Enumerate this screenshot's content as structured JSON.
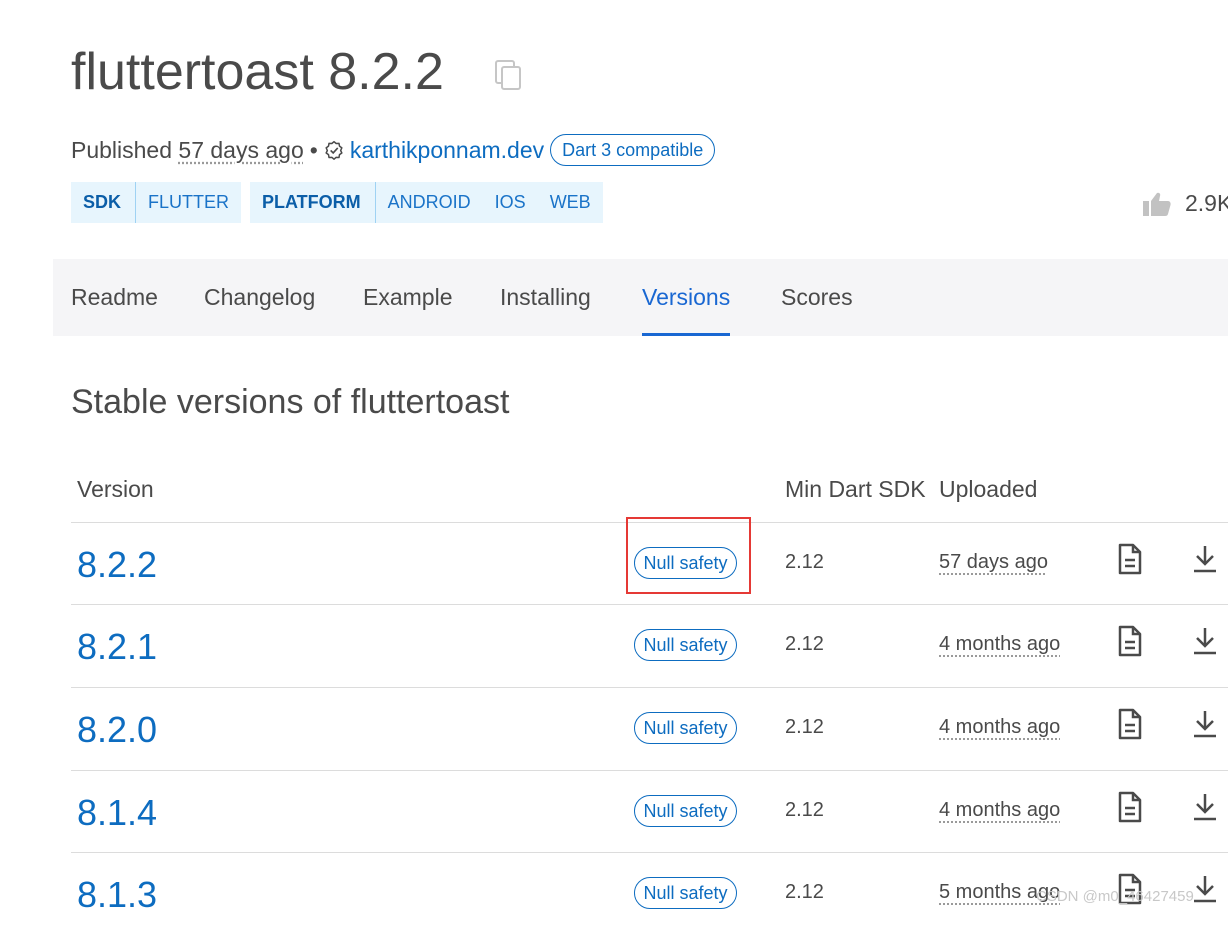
{
  "package": {
    "title": "fluttertoast 8.2.2",
    "copy_icon": "copy-icon"
  },
  "meta": {
    "published_label": "Published",
    "published_ago": "57 days ago",
    "separator": "•",
    "verified_icon": "verified-publisher-icon",
    "publisher": "karthikponnam.dev",
    "compat_badge": "Dart 3 compatible"
  },
  "tags": {
    "sdk": {
      "label": "SDK",
      "values": [
        "FLUTTER"
      ]
    },
    "platform": {
      "label": "PLATFORM",
      "values": [
        "ANDROID",
        "IOS",
        "WEB"
      ]
    }
  },
  "likes": {
    "icon": "thumbs-up-icon",
    "count": "2.9K"
  },
  "tabs": [
    {
      "label": "Readme",
      "active": false
    },
    {
      "label": "Changelog",
      "active": false
    },
    {
      "label": "Example",
      "active": false
    },
    {
      "label": "Installing",
      "active": false
    },
    {
      "label": "Versions",
      "active": true
    },
    {
      "label": "Scores",
      "active": false
    }
  ],
  "section_title": "Stable versions of fluttertoast",
  "table": {
    "headers": {
      "version": "Version",
      "min_sdk": "Min Dart SDK",
      "uploaded": "Uploaded"
    },
    "rows": [
      {
        "version": "8.2.2",
        "badge": "Null safety",
        "min_sdk": "2.12",
        "uploaded": "57 days ago"
      },
      {
        "version": "8.2.1",
        "badge": "Null safety",
        "min_sdk": "2.12",
        "uploaded": "4 months ago"
      },
      {
        "version": "8.2.0",
        "badge": "Null safety",
        "min_sdk": "2.12",
        "uploaded": "4 months ago"
      },
      {
        "version": "8.1.4",
        "badge": "Null safety",
        "min_sdk": "2.12",
        "uploaded": "4 months ago"
      },
      {
        "version": "8.1.3",
        "badge": "Null safety",
        "min_sdk": "2.12",
        "uploaded": "5 months ago"
      }
    ],
    "row_icons": {
      "docs": "document-icon",
      "download": "download-icon"
    }
  },
  "annotation": {
    "highlight_color": "#e53935"
  },
  "watermark": "CSDN @m0_46427459",
  "colors": {
    "link": "#0d6cc0",
    "tag_bg": "#e7f5fd",
    "tab_active": "#1967d2",
    "tabbar_bg": "#f5f5f7"
  }
}
